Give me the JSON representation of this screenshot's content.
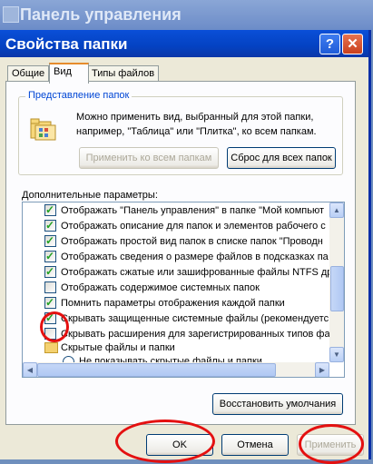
{
  "background_window": {
    "title": "Панель управления"
  },
  "dialog": {
    "title": "Свойства папки",
    "help": "?",
    "close": "✕"
  },
  "tabs": [
    {
      "label": "Общие"
    },
    {
      "label": "Вид"
    },
    {
      "label": "Типы файлов"
    }
  ],
  "group": {
    "legend": "Представление папок",
    "description": "Можно применить вид, выбранный для этой папки, например, \"Таблица\" или \"Плитка\", ко всем папкам.",
    "apply_all": "Применить ко всем папкам",
    "reset_all": "Сброс для всех папок"
  },
  "advanced": {
    "label": "Дополнительные параметры:",
    "items": [
      {
        "text": "Отображать \"Панель управления\" в папке \"Мой компьют",
        "checked": true
      },
      {
        "text": "Отображать описание для папок и элементов рабочего с",
        "checked": true
      },
      {
        "text": "Отображать простой вид папок в списке папок \"Проводн",
        "checked": true
      },
      {
        "text": "Отображать сведения о размере файлов в подсказках па",
        "checked": true
      },
      {
        "text": "Отображать сжатые или зашифрованные файлы NTFS дру",
        "checked": true
      },
      {
        "text": "Отображать содержимое системных папок",
        "checked": false
      },
      {
        "text": "Помнить параметры отображения каждой папки",
        "checked": true
      },
      {
        "text": "Скрывать защищенные системные файлы (рекомендуетс",
        "checked": true
      },
      {
        "text": "Скрывать расширения для зарегистрированных типов фа",
        "checked": false
      },
      {
        "text": "Скрытые файлы и папки"
      },
      {
        "text": "Не показывать скрытые файлы и папки"
      }
    ],
    "restore_defaults": "Восстановить умолчания"
  },
  "buttons": {
    "ok": "OK",
    "cancel": "Отмена",
    "apply": "Применить"
  },
  "colors": {
    "title_bar": "#0442c2",
    "face": "#ece9d8",
    "annotation": "#e41010",
    "checkmark": "#21a121"
  }
}
